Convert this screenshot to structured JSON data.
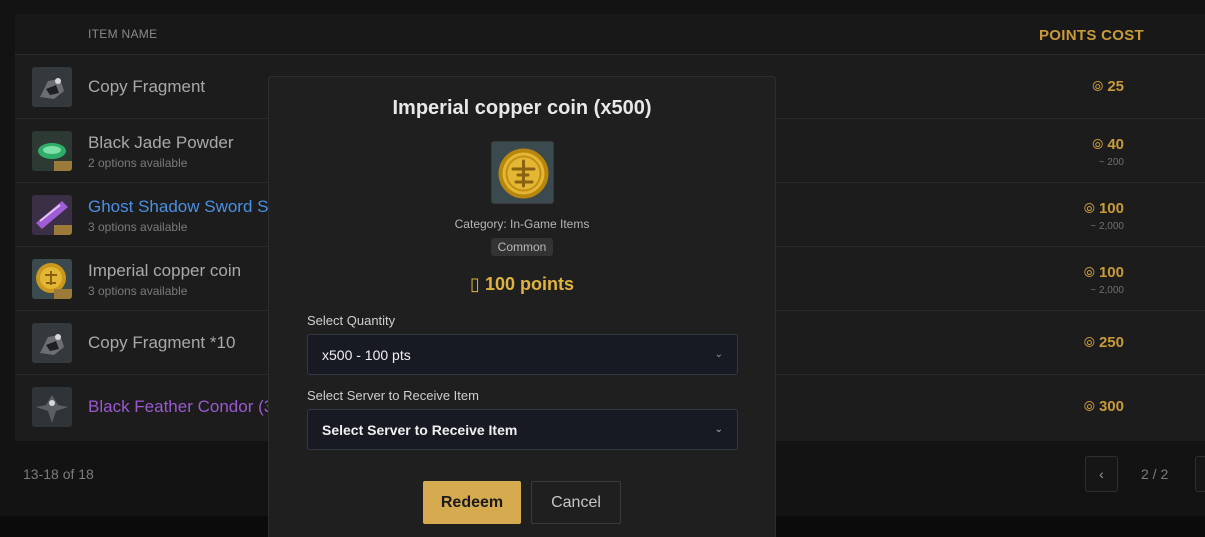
{
  "table": {
    "headers": {
      "name": "ITEM NAME",
      "cost": "POINTS COST"
    },
    "rows": [
      {
        "title": "Copy Fragment",
        "subtitle": "",
        "cost": "25",
        "approx": "",
        "style": "normal",
        "icon": "copy-fragment-icon"
      },
      {
        "title": "Black Jade Powder",
        "subtitle": "2 options available",
        "cost": "40",
        "approx": "~ 200",
        "style": "normal",
        "icon": "jade-powder-icon"
      },
      {
        "title": "Ghost Shadow Sword Sc",
        "subtitle": "3 options available",
        "cost": "100",
        "approx": "~ 2,000",
        "style": "blue",
        "icon": "sword-scroll-icon"
      },
      {
        "title": "Imperial copper coin",
        "subtitle": "3 options available",
        "cost": "100",
        "approx": "~ 2,000",
        "style": "normal",
        "icon": "copper-coin-icon"
      },
      {
        "title": "Copy Fragment *10",
        "subtitle": "",
        "cost": "250",
        "approx": "",
        "style": "normal",
        "icon": "copy-fragment-icon"
      },
      {
        "title": "Black Feather Condor (3",
        "subtitle": "",
        "cost": "300",
        "approx": "",
        "style": "purple",
        "icon": "condor-icon"
      }
    ]
  },
  "footer": {
    "range": "13-18 of 18",
    "prev_icon": "‹",
    "page_indicator": "2 / 2"
  },
  "modal": {
    "title": "Imperial copper coin (x500)",
    "category": "Category: In-Game Items",
    "rarity": "Common",
    "price": "▯ 100 points",
    "quantity_label": "Select Quantity",
    "quantity_value": "x500 - 100 pts",
    "server_label": "Select Server to Receive Item",
    "server_value": "Select Server to Receive Item",
    "redeem_label": "Redeem",
    "cancel_label": "Cancel",
    "image_icon": "copper-coin-icon"
  },
  "icons": {
    "coin": "⦾",
    "chevron": "⌄"
  },
  "colors": {
    "accent_gold": "#d6aa4f",
    "cost_gold": "#c99a3a",
    "price_gold": "#e0b33c",
    "link_blue": "#4a90e2",
    "epic_purple": "#9b59d0"
  }
}
